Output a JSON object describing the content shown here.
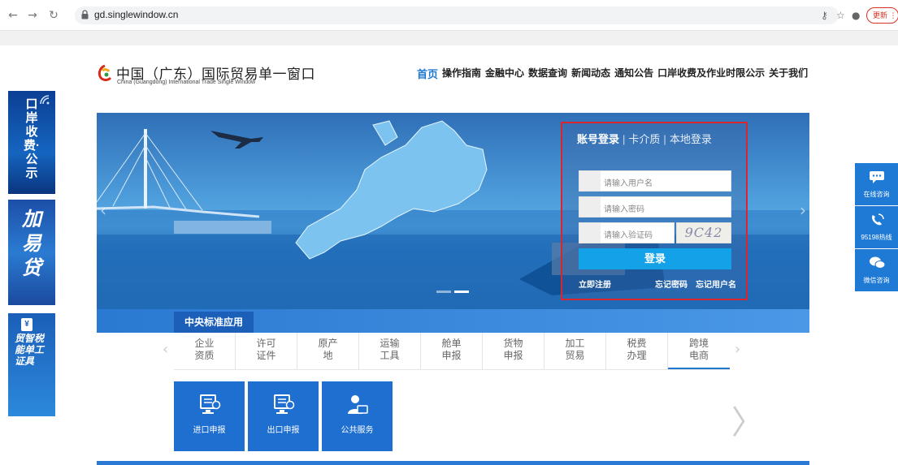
{
  "browser": {
    "url": "gd.singlewindow.cn",
    "update_label": "更新"
  },
  "header": {
    "logo_cn": "中国（广东）国际贸易单一窗口",
    "logo_en": "China (Guangdong) International Trade Single Window",
    "nav": [
      "首页",
      "操作指南",
      "金融中心",
      "数据查询",
      "新闻动态",
      "通知公告",
      "口岸收费及作业时限公示",
      "关于我们"
    ]
  },
  "left_ads": {
    "ad1": "口岸收费·公示",
    "ad2": "加易贷",
    "ad3": "贸智税能单工证具"
  },
  "login": {
    "tab_account": "账号登录",
    "tab_card": "卡介质",
    "tab_local": "本地登录",
    "username_placeholder": "请输入用户名",
    "password_placeholder": "请输入密码",
    "captcha_placeholder": "请输入验证码",
    "captcha_text": "9C42",
    "submit": "登录",
    "register": "立即注册",
    "forgot_password": "忘记密码",
    "forgot_username": "忘记用户名"
  },
  "right_service": {
    "online": "在线咨询",
    "hotline": "95198热线",
    "wechat": "微信咨询"
  },
  "apps": {
    "section_title": "中央标准应用",
    "categories": [
      {
        "l1": "企业",
        "l2": "资质"
      },
      {
        "l1": "许可",
        "l2": "证件"
      },
      {
        "l1": "原产",
        "l2": "地"
      },
      {
        "l1": "运输",
        "l2": "工具"
      },
      {
        "l1": "舱单",
        "l2": "申报"
      },
      {
        "l1": "货物",
        "l2": "申报"
      },
      {
        "l1": "加工",
        "l2": "贸易"
      },
      {
        "l1": "税费",
        "l2": "办理"
      },
      {
        "l1": "跨境",
        "l2": "电商"
      }
    ],
    "tiles": [
      "进口申报",
      "出口申报",
      "公共服务"
    ]
  },
  "colors": {
    "brand_blue": "#1e78d2",
    "login_border": "#d9262e",
    "login_button": "#13a1e7"
  }
}
